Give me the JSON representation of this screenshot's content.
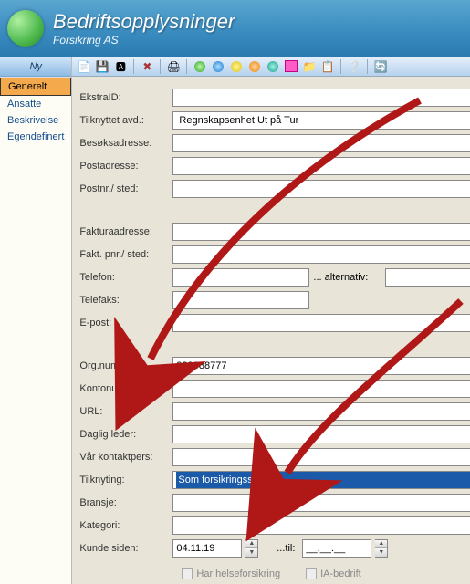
{
  "header": {
    "title": "Bedriftsopplysninger",
    "subtitle": "Forsikring AS"
  },
  "sidebar": {
    "tab": "Ny",
    "items": [
      {
        "label": "Generelt",
        "active": true
      },
      {
        "label": "Ansatte",
        "active": false
      },
      {
        "label": "Beskrivelse",
        "active": false
      },
      {
        "label": "Egendefinert",
        "active": false
      }
    ]
  },
  "form": {
    "ekstraid": {
      "label": "EkstraID:",
      "value": ""
    },
    "avd": {
      "label": "Tilknyttet avd.:",
      "value": "Regnskapsenhet Ut på Tur"
    },
    "besok": {
      "label": "Besøksadresse:",
      "value": ""
    },
    "post": {
      "label": "Postadresse:",
      "value": ""
    },
    "postnrsted": {
      "label": "Postnr./ sted:",
      "value": ""
    },
    "faktura": {
      "label": "Fakturaadresse:",
      "value": ""
    },
    "faktpnrsted": {
      "label": "Fakt. pnr./ sted:",
      "value": ""
    },
    "telefon": {
      "label": "Telefon:",
      "value": "",
      "alt_label": "... alternativ:",
      "alt_value": ""
    },
    "telefaks": {
      "label": "Telefaks:",
      "value": ""
    },
    "epost": {
      "label": "E-post:",
      "value": ""
    },
    "orgnr": {
      "label": "Org.nummer:",
      "value": "999888777"
    },
    "kontonr": {
      "label": "Kontonummer:",
      "value": ""
    },
    "url": {
      "label": "URL:",
      "value": ""
    },
    "dagligleder": {
      "label": "Daglig leder:",
      "value": ""
    },
    "kontaktpers": {
      "label": "Vår kontaktpers:",
      "value": ""
    },
    "tilknytning": {
      "label": "Tilknyting:",
      "value": "Som forsikringsselskap"
    },
    "bransje": {
      "label": "Bransje:",
      "value": ""
    },
    "kategori": {
      "label": "Kategori:",
      "value": ""
    },
    "kundesiden": {
      "label": "Kunde siden:",
      "value": "04.11.19",
      "til_label": "...til:",
      "til_value": "__.__.__"
    },
    "helseforsikring": {
      "label": "Har helseforsikring"
    },
    "iabedrift": {
      "label": "IA-bedrift"
    }
  }
}
